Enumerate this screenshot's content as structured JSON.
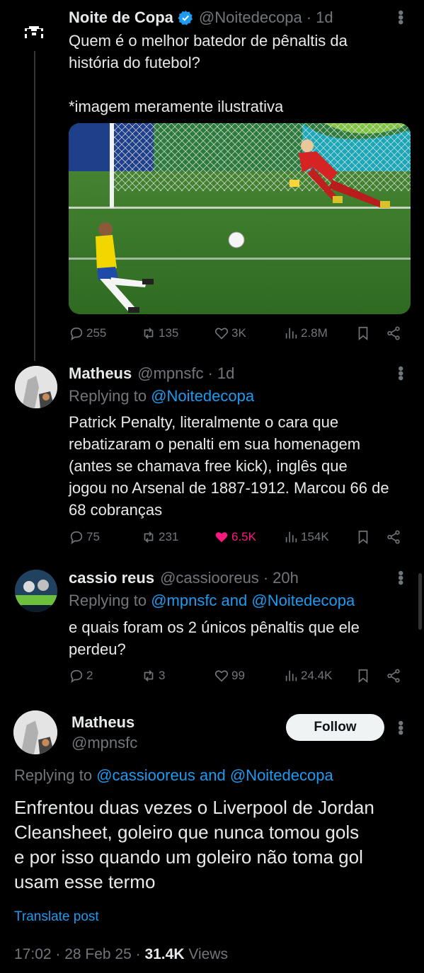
{
  "post1": {
    "name": "Noite de Copa",
    "handle": "@Noitedecopa",
    "time": "1d",
    "text": "Quem é o melhor batedor de pênaltis da\nhistória do futebol?\n\n*imagem meramente ilustrativa",
    "stats": {
      "replies": "255",
      "reposts": "135",
      "likes": "3K",
      "views": "2.8M"
    }
  },
  "post2": {
    "name": "Matheus",
    "handle": "@mpnsfc",
    "time": "1d",
    "replying_prefix": "Replying to ",
    "replying_to": "@Noitedecopa",
    "text": "Patrick Penalty, literalmente o cara que\nrebatizaram o penalti em sua homenagem\n(antes se chamava free kick), inglês que\njogou no Arsenal de 1887-1912. Marcou 66 de\n68 cobranças",
    "stats": {
      "replies": "75",
      "reposts": "231",
      "likes": "6.5K",
      "views": "154K"
    }
  },
  "post3": {
    "name": "cassio reus",
    "handle": "@cassiooreus",
    "time": "20h",
    "replying_prefix": "Replying to ",
    "replying_to": "@mpnsfc and @Noitedecopa",
    "text": "e quais foram os 2 únicos pênaltis que ele\nperdeu?",
    "stats": {
      "replies": "2",
      "reposts": "3",
      "likes": "99",
      "views": "24.4K"
    }
  },
  "main": {
    "name": "Matheus",
    "handle": "@mpnsfc",
    "follow_label": "Follow",
    "replying_prefix": "Replying to ",
    "replying_to": "@cassiooreus and @Noitedecopa",
    "text": "Enfrentou duas vezes o Liverpool de Jordan\nCleansheet, goleiro que nunca tomou gols\ne por isso quando um goleiro não toma gol\nusam esse termo",
    "translate": "Translate post",
    "time": "17:02 · 28 Feb 25 · ",
    "views_count": "31.4K",
    "views_label": " Views"
  },
  "colors": {
    "accent": "#1d9bf0",
    "like": "#f91880",
    "muted": "#71767b",
    "background": "#000000"
  }
}
